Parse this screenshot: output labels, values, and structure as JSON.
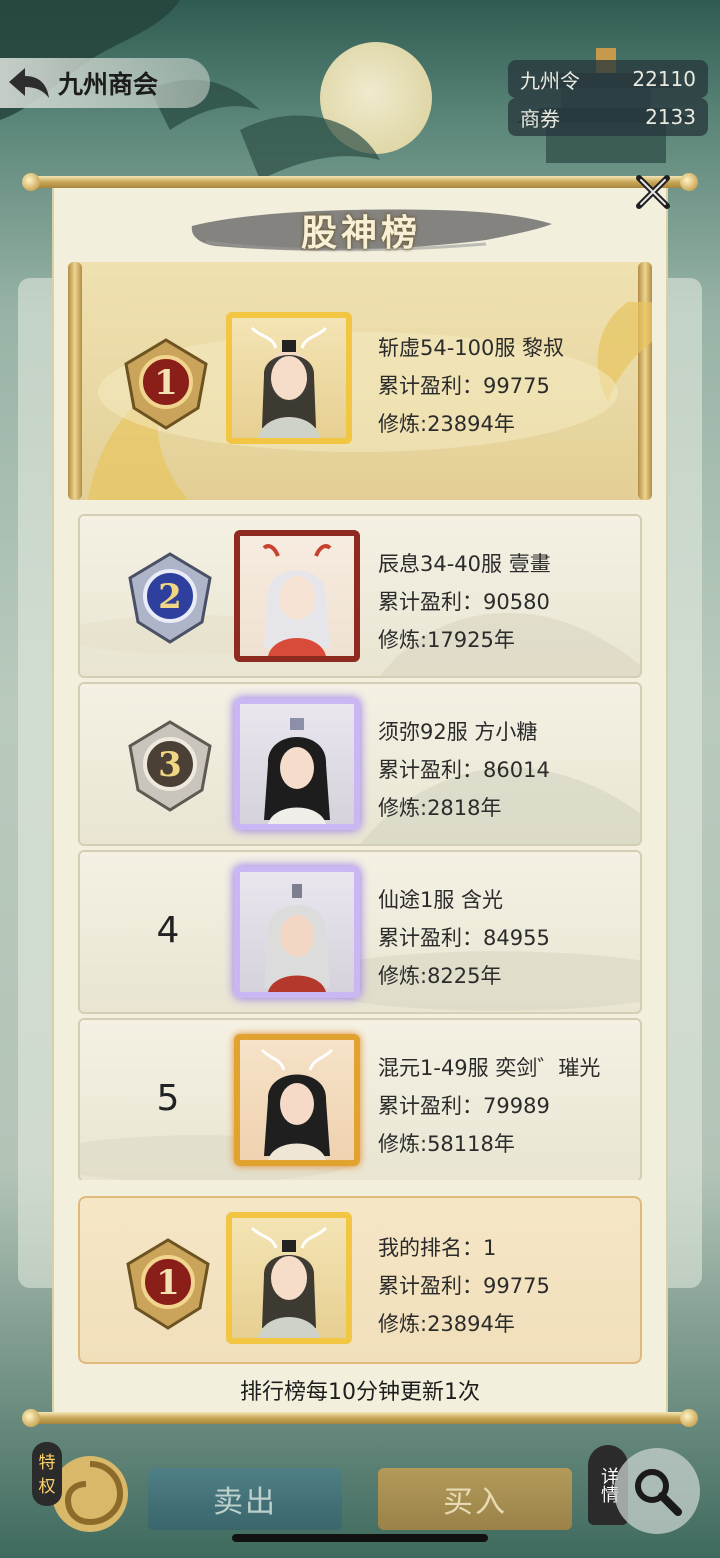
{
  "header": {
    "title": "九州商会",
    "currencies": [
      {
        "name": "九州令",
        "value": "22110"
      },
      {
        "name": "商券",
        "value": "2133"
      }
    ]
  },
  "modal": {
    "title": "股神榜",
    "footer": "排行榜每10分钟更新1次",
    "entries": [
      {
        "rank": "1",
        "line1": "斩虚54-100服 黎叔",
        "line2": "累计盈利：99775",
        "line3": "修炼:23894年"
      },
      {
        "rank": "2",
        "line1": "辰息34-40服 壹畫",
        "line2": "累计盈利：90580",
        "line3": "修炼:17925年"
      },
      {
        "rank": "3",
        "line1": "须弥92服 方小糖",
        "line2": "累计盈利：86014",
        "line3": "修炼:2818年"
      },
      {
        "rank": "4",
        "line1": "仙途1服 含光",
        "line2": "累计盈利：84955",
        "line3": "修炼:8225年"
      },
      {
        "rank": "5",
        "line1": "混元1-49服 奕剑゛璀光",
        "line2": "累计盈利：79989",
        "line3": "修炼:58118年"
      }
    ],
    "mine": {
      "rank": "1",
      "line1": "我的排名：1",
      "line2": "累计盈利：99775",
      "line3": "修炼:23894年"
    }
  },
  "bottom": {
    "privilege_label": "特权",
    "sell_label": "卖出",
    "buy_label": "买入",
    "details_label": "详情"
  },
  "colors": {
    "rank1": "#8a1f1a",
    "rank2": "#2f3f9e",
    "rank3": "#4a4036",
    "gold": "#f2c542"
  },
  "icons": [
    "back-arrow-icon",
    "close-icon",
    "search-icon",
    "rank-badge-icon"
  ]
}
